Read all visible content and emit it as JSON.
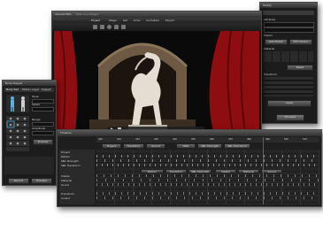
{
  "main_window": {
    "title": "iClone4 PRO",
    "subtitle": "Table and Staged",
    "menu": [
      "Project",
      "Stage",
      "Set",
      "Actor",
      "Animation",
      "Export"
    ]
  },
  "viewport": {
    "scene": "white horse statue in arched stone gateway with red curtains",
    "sky_color": "#0a0a0a",
    "curtain_color": "#8e0d10",
    "arch_color": "#6e5a44",
    "horse_color": "#e4ddd2"
  },
  "modify_panel": {
    "title": "Modify",
    "section_labels": [
      "Attribute",
      "Motion",
      "Material",
      "Transform"
    ],
    "button_labels": [
      "Add Motion",
      "Edit Motion",
      "Reset"
    ],
    "action_button": "Apply",
    "footer_button": "Proceed"
  },
  "body_puppet": {
    "title": "Body Puppet",
    "tabs": [
      "Body Part",
      "Motion Layer",
      "Puppet"
    ],
    "fields": [
      "Style",
      "Speed",
      "Range",
      "Amplitude"
    ],
    "buttons": [
      "Preview",
      "Record"
    ]
  },
  "timeline": {
    "title": "Timeline",
    "frame_numbers": [
      "400",
      "410",
      "420",
      "430",
      "440",
      "450",
      "460",
      "470",
      "480",
      "490",
      "500",
      "510"
    ],
    "tracks": [
      "Project",
      "Transform",
      "Sound",
      "HDR",
      "SBL Strength",
      "SBL Transform"
    ],
    "rows": [
      "Project",
      "Motion",
      "SBL Strength",
      "SBL Transform",
      "Visible",
      "Material",
      "Sound",
      "Transform",
      "Collect"
    ],
    "sub_rows": [
      "Motion",
      "Visible",
      "Material",
      "UV",
      "Sound"
    ],
    "accent_color": "#c0383c"
  }
}
